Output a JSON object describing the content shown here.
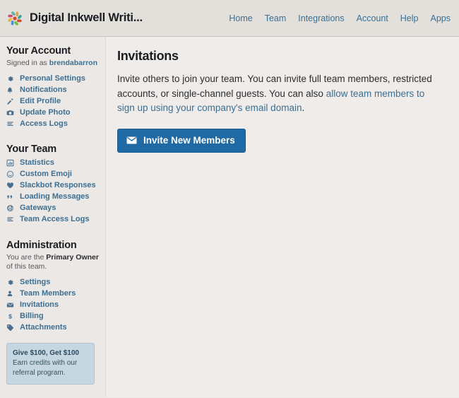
{
  "header": {
    "logo_icon": "slack-pinwheel-icon",
    "title": "Digital Inkwell Writi...",
    "nav": [
      {
        "label": "Home",
        "name": "nav-home"
      },
      {
        "label": "Team",
        "name": "nav-team"
      },
      {
        "label": "Integrations",
        "name": "nav-integrations"
      },
      {
        "label": "Account",
        "name": "nav-account"
      },
      {
        "label": "Help",
        "name": "nav-help"
      },
      {
        "label": "Apps",
        "name": "nav-apps"
      }
    ]
  },
  "sidebar": {
    "account": {
      "heading": "Your Account",
      "signed_in_prefix": "Signed in as ",
      "username": "brendabarron",
      "items": [
        {
          "label": "Personal Settings",
          "icon": "gear-icon"
        },
        {
          "label": "Notifications",
          "icon": "bell-icon"
        },
        {
          "label": "Edit Profile",
          "icon": "pencil-icon"
        },
        {
          "label": "Update Photo",
          "icon": "camera-icon"
        },
        {
          "label": "Access Logs",
          "icon": "list-lines-icon"
        }
      ]
    },
    "team": {
      "heading": "Your Team",
      "items": [
        {
          "label": "Statistics",
          "icon": "bar-chart-icon"
        },
        {
          "label": "Custom Emoji",
          "icon": "smiley-icon"
        },
        {
          "label": "Slackbot Responses",
          "icon": "heart-icon"
        },
        {
          "label": "Loading Messages",
          "icon": "quote-icon"
        },
        {
          "label": "Gateways",
          "icon": "globe-icon"
        },
        {
          "label": "Team Access Logs",
          "icon": "list-lines-icon"
        }
      ]
    },
    "administration": {
      "heading": "Administration",
      "note_prefix": "You are the ",
      "note_strong": "Primary Owner",
      "note_suffix": " of this team.",
      "items": [
        {
          "label": "Settings",
          "icon": "gear-icon"
        },
        {
          "label": "Team Members",
          "icon": "person-icon"
        },
        {
          "label": "Invitations",
          "icon": "envelope-icon"
        },
        {
          "label": "Billing",
          "icon": "dollar-icon"
        },
        {
          "label": "Attachments",
          "icon": "tag-icon"
        }
      ]
    },
    "promo": {
      "title": "Give $100, Get $100",
      "text": "Earn credits with our referral program."
    }
  },
  "main": {
    "title": "Invitations",
    "intro_part1": "Invite others to join your team. You can invite full team members, restricted accounts, or single-channel guests. You can also ",
    "intro_link": "allow team members to sign up using your company's email domain",
    "intro_part2": ".",
    "invite_button": "Invite New Members",
    "invite_button_icon": "envelope-icon"
  },
  "colors": {
    "accent_link": "#3b6f94",
    "button_blue": "#1f6aa5",
    "page_bg": "#ece8e5",
    "header_bg": "#e3e0dc",
    "promo_bg": "#c7d7e2"
  }
}
